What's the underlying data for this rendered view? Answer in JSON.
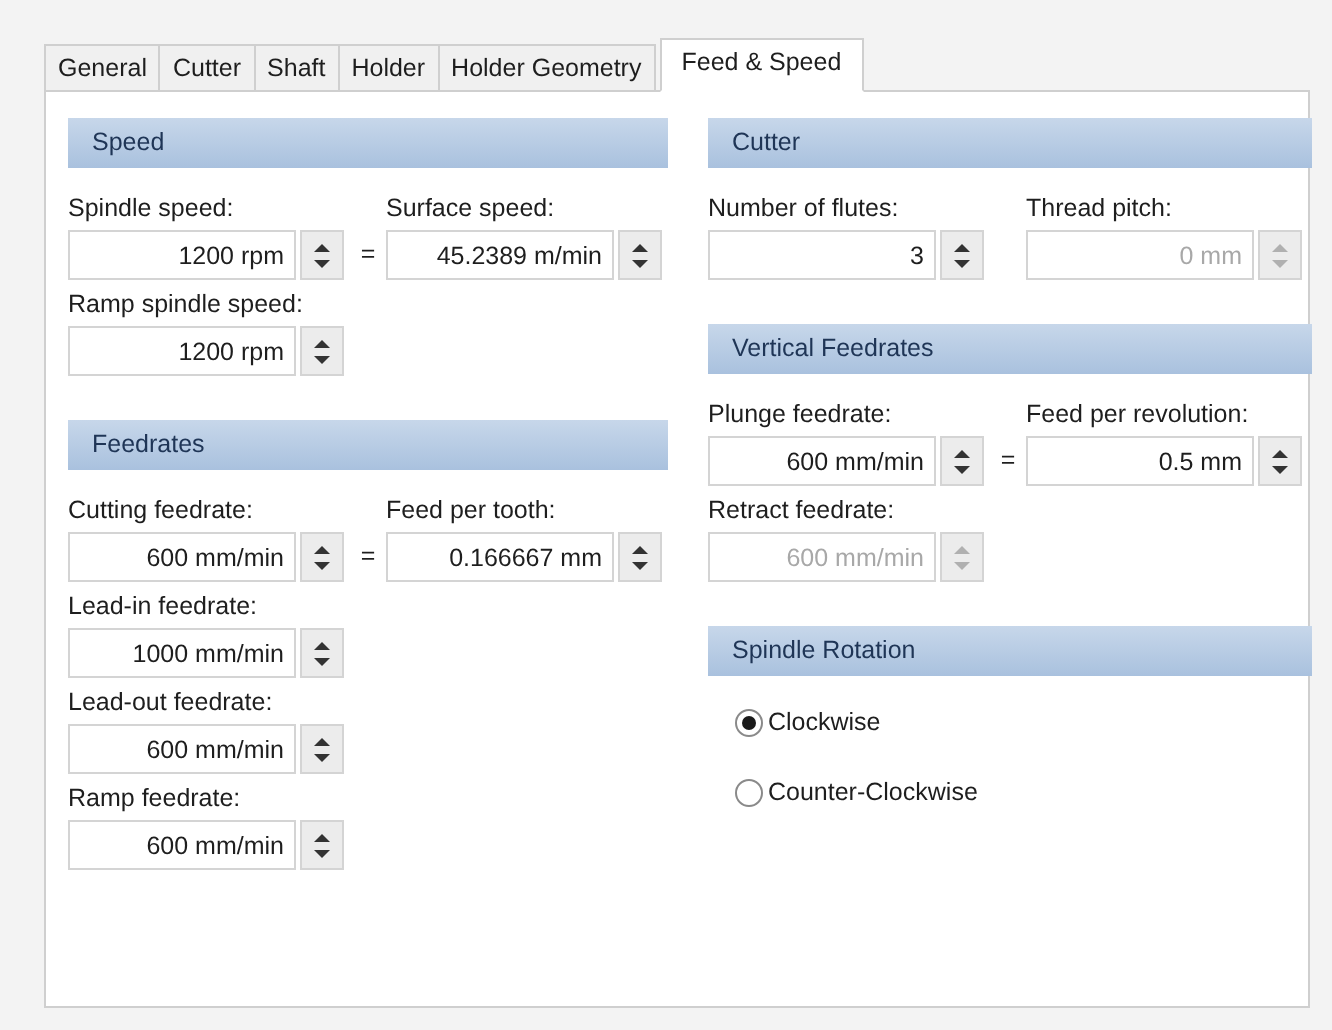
{
  "tabs": [
    {
      "label": "General",
      "selected": false
    },
    {
      "label": "Cutter",
      "selected": false
    },
    {
      "label": "Shaft",
      "selected": false
    },
    {
      "label": "Holder",
      "selected": false
    },
    {
      "label": "Holder Geometry",
      "selected": false
    },
    {
      "label": "Feed & Speed",
      "selected": true
    }
  ],
  "columns": [
    {
      "sections": [
        {
          "title": "Speed",
          "kind": "fields",
          "rows": [
            {
              "separator": "=",
              "fields": [
                {
                  "label": "Spindle speed:",
                  "value": "1200 rpm",
                  "disabled": false
                },
                {
                  "label": "Surface speed:",
                  "value": "45.2389 m/min",
                  "disabled": false
                }
              ]
            },
            {
              "fields": [
                {
                  "label": "Ramp spindle speed:",
                  "value": "1200 rpm",
                  "disabled": false
                }
              ]
            }
          ]
        },
        {
          "title": "Feedrates",
          "kind": "fields",
          "rows": [
            {
              "separator": "=",
              "fields": [
                {
                  "label": "Cutting feedrate:",
                  "value": "600 mm/min",
                  "disabled": false
                },
                {
                  "label": "Feed per tooth:",
                  "value": "0.166667 mm",
                  "disabled": false
                }
              ]
            },
            {
              "fields": [
                {
                  "label": "Lead-in feedrate:",
                  "value": "1000 mm/min",
                  "disabled": false
                }
              ]
            },
            {
              "fields": [
                {
                  "label": "Lead-out feedrate:",
                  "value": "600 mm/min",
                  "disabled": false
                }
              ]
            },
            {
              "fields": [
                {
                  "label": "Ramp feedrate:",
                  "value": "600 mm/min",
                  "disabled": false
                }
              ]
            }
          ]
        }
      ]
    },
    {
      "sections": [
        {
          "title": "Cutter",
          "kind": "fields",
          "rows": [
            {
              "fields": [
                {
                  "label": "Number of flutes:",
                  "value": "3",
                  "disabled": false
                },
                {
                  "label": "Thread pitch:",
                  "value": "0 mm",
                  "disabled": true
                }
              ]
            }
          ]
        },
        {
          "title": "Vertical Feedrates",
          "kind": "fields",
          "rows": [
            {
              "separator": "=",
              "fields": [
                {
                  "label": "Plunge feedrate:",
                  "value": "600 mm/min",
                  "disabled": false
                },
                {
                  "label": "Feed per revolution:",
                  "value": "0.5 mm",
                  "disabled": false
                }
              ]
            },
            {
              "fields": [
                {
                  "label": "Retract feedrate:",
                  "value": "600 mm/min",
                  "disabled": true
                }
              ]
            }
          ]
        },
        {
          "title": "Spindle Rotation",
          "kind": "radios",
          "options": [
            {
              "label": "Clockwise",
              "selected": true
            },
            {
              "label": "Counter-Clockwise",
              "selected": false
            }
          ]
        }
      ]
    }
  ]
}
